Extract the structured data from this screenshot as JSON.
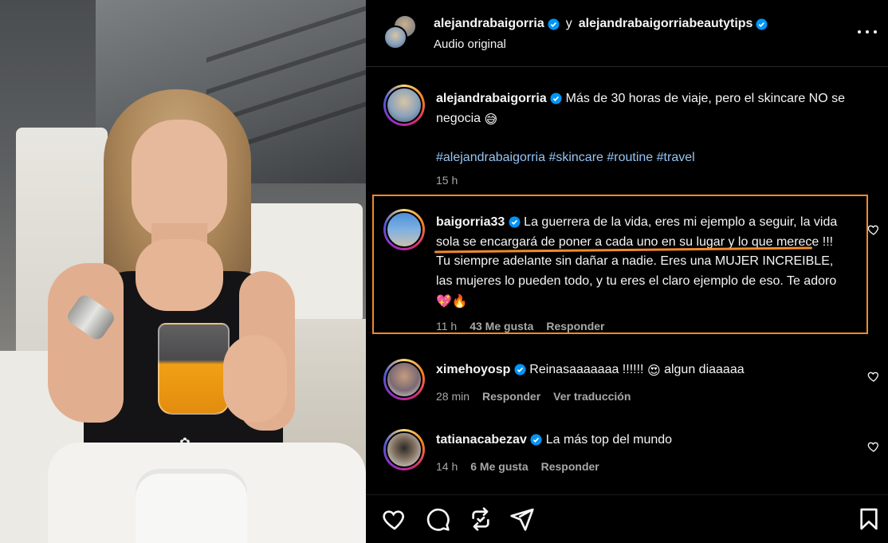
{
  "header": {
    "user1": "alejandrabaigorria",
    "conjunction": "y",
    "user2": "alejandrabaigorriabeautytips",
    "audio": "Audio original"
  },
  "caption": {
    "username": "alejandrabaigorria",
    "text": "Más de 30 horas de viaje, pero el skincare NO se negocia",
    "emoji": "😅",
    "hashtags": [
      "#alejandrabaigorria",
      "#skincare",
      "#routine",
      "#travel"
    ],
    "time": "15 h"
  },
  "comments": [
    {
      "username": "baigorria33",
      "text_before": "La guerrera de la vida, eres mi ejemplo a seguir,",
      "text_highlight": "la vida sola se encargará de poner a cada uno en su lugar",
      "text_after": "y lo que merece !!! Tu siempre adelante sin dañar a nadie. Eres una MUJER INCREIBLE, las mujeres lo pueden todo, y tu eres el claro ejemplo de eso. Te adoro",
      "emoji": "💖🔥",
      "time": "11 h",
      "likes": "43 Me gusta",
      "reply": "Responder"
    },
    {
      "username": "ximehoyosp",
      "text": "Reinasaaaaaaa !!!!!!",
      "emoji": "😍",
      "text_after": "algun diaaaaa",
      "time": "28 min",
      "reply": "Responder",
      "translate": "Ver traducción"
    },
    {
      "username": "tatianacabezav",
      "text": "La más top del mundo",
      "time": "14 h",
      "likes": "6 Me gusta",
      "reply": "Responder"
    }
  ],
  "icons": {
    "like": "heart-icon",
    "comment": "comment-icon",
    "share": "repost-icon",
    "send": "send-icon",
    "save": "bookmark-icon"
  },
  "colors": {
    "verified": "#0095f6",
    "highlight": "#f28a2a",
    "hashtag": "#95c5f5",
    "meta": "#a8a8a8"
  }
}
